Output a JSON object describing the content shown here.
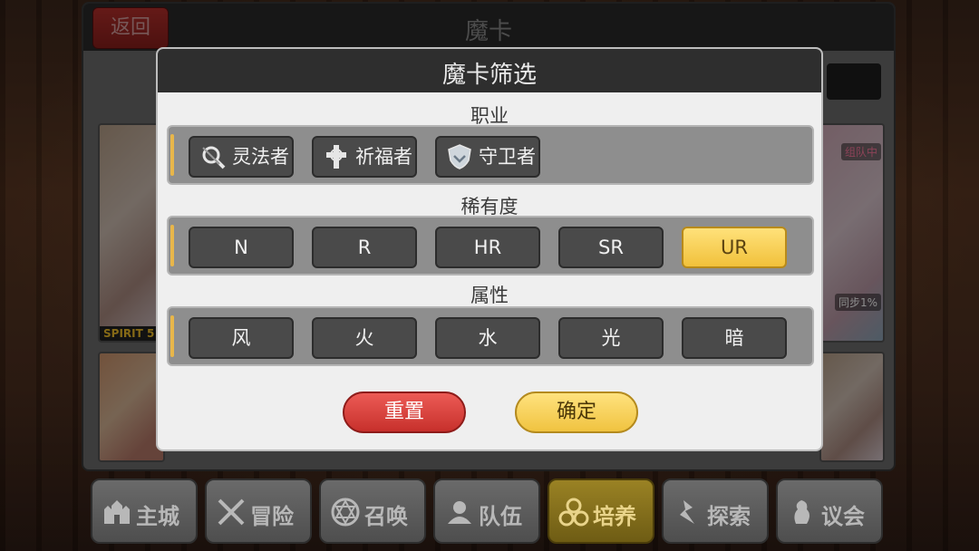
{
  "main": {
    "title": "魔卡",
    "back_label": "返回",
    "cards": [
      {
        "tag": "组队中"
      },
      {
        "tag": "同步1%"
      },
      {
        "spirit": "SPIRIT 5"
      }
    ]
  },
  "modal": {
    "title": "魔卡筛选",
    "class_section": {
      "title": "职业",
      "options": [
        {
          "label": "灵法者",
          "icon": "wand-icon"
        },
        {
          "label": "祈福者",
          "icon": "cross-icon"
        },
        {
          "label": "守卫者",
          "icon": "shield-icon"
        }
      ]
    },
    "rarity_section": {
      "title": "稀有度",
      "options": [
        "N",
        "R",
        "HR",
        "SR",
        "UR"
      ],
      "selected": "UR"
    },
    "attribute_section": {
      "title": "属性",
      "options": [
        "风",
        "火",
        "水",
        "光",
        "暗"
      ]
    },
    "reset_label": "重置",
    "confirm_label": "确定"
  },
  "nav": {
    "items": [
      {
        "label": "主城",
        "icon": "castle-icon"
      },
      {
        "label": "冒险",
        "icon": "crossed-swords-icon"
      },
      {
        "label": "召唤",
        "icon": "summon-circle-icon"
      },
      {
        "label": "队伍",
        "icon": "team-icon"
      },
      {
        "label": "培养",
        "icon": "cultivate-icon"
      },
      {
        "label": "探索",
        "icon": "explore-icon"
      },
      {
        "label": "议会",
        "icon": "council-icon"
      }
    ],
    "active": "培养"
  },
  "colors": {
    "accent_gold": "#f1c13b",
    "danger_red": "#c7302c",
    "modal_header": "#2e2e2e"
  }
}
